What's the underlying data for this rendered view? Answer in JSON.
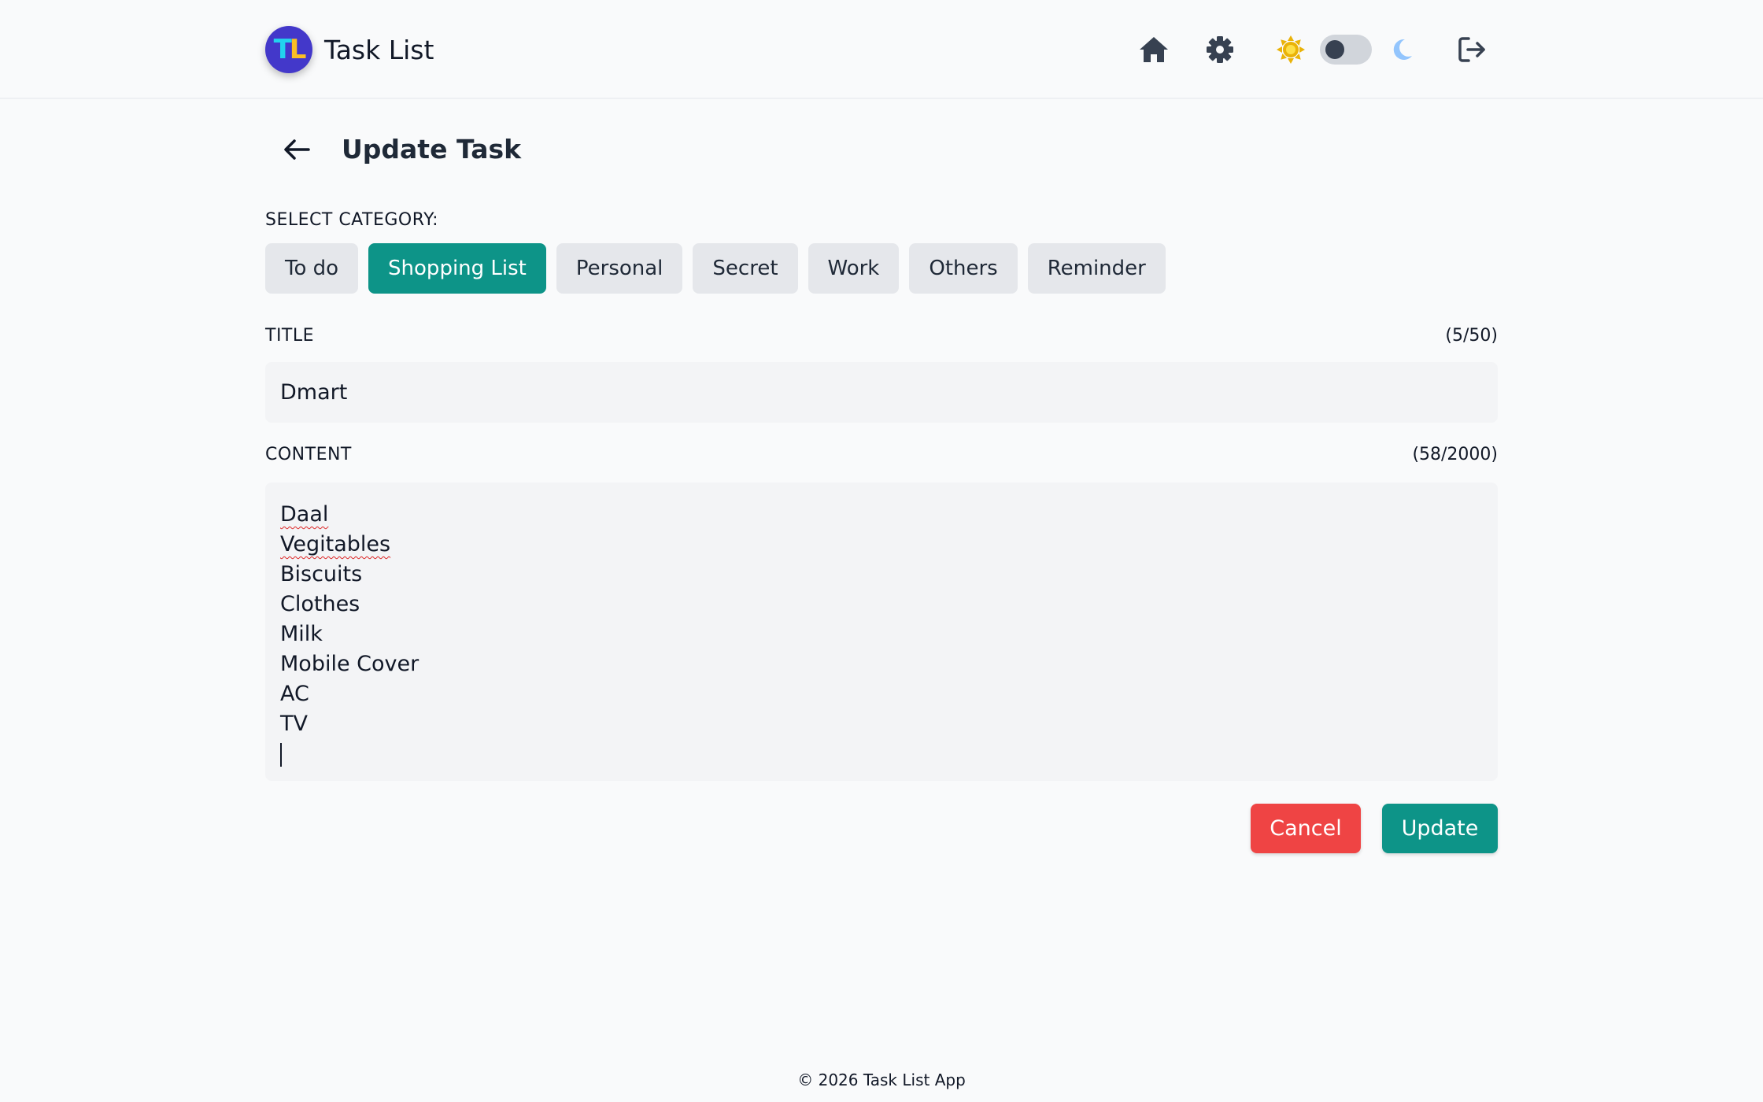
{
  "header": {
    "app_title": "Task List",
    "logo_letters": {
      "first": "T",
      "second": "L"
    },
    "icons": {
      "home": "home-icon",
      "settings": "gear-icon",
      "light_mode": "sun-icon",
      "theme_toggle": "toggle-switch",
      "dark_mode": "moon-icon",
      "logout": "logout-icon"
    },
    "theme_toggle_state": "light"
  },
  "page": {
    "title": "Update Task",
    "back_icon": "arrow-left-icon"
  },
  "category": {
    "label": "SELECT CATEGORY:",
    "options": [
      "To do",
      "Shopping List",
      "Personal",
      "Secret",
      "Work",
      "Others",
      "Reminder"
    ],
    "selected": "Shopping List"
  },
  "title_field": {
    "label": "TITLE",
    "counter": "(5/50)",
    "value": "Dmart"
  },
  "content_field": {
    "label": "CONTENT",
    "counter": "(58/2000)",
    "lines": [
      "Daal",
      "Vegitables",
      "Biscuits",
      "Clothes",
      "Milk",
      "Mobile Cover",
      "AC",
      "TV"
    ]
  },
  "actions": {
    "cancel_label": "Cancel",
    "update_label": "Update"
  },
  "footer": {
    "text": "© 2026 Task List App"
  },
  "colors": {
    "accent": "#0d9488",
    "danger": "#ef4444",
    "logo_bg": "#4338ca",
    "sun": "#eab308",
    "moon": "#93c5fd"
  }
}
